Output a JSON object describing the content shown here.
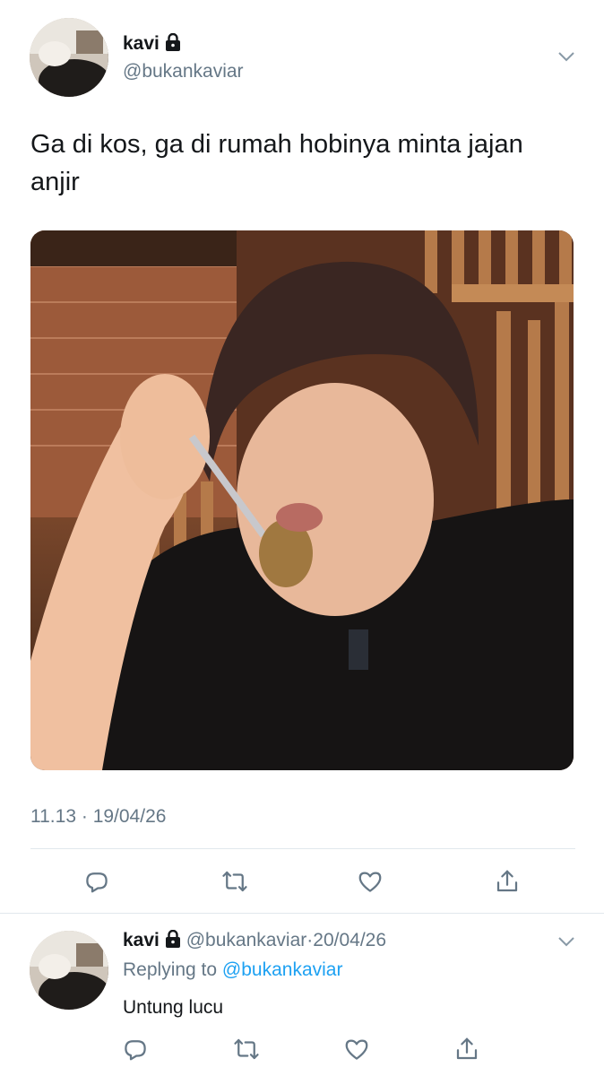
{
  "tweet": {
    "display_name": "kavi",
    "handle": "@bukankaviar",
    "text": "Ga di kos, ga di rumah hobinya minta jajan anjir",
    "time": "11.13",
    "separator": "·",
    "date": "19/04/26"
  },
  "reply": {
    "display_name": "kavi",
    "handle": "@bukankaviar",
    "separator": "·",
    "date": "20/04/26",
    "replying_prefix": "Replying to",
    "replying_to": "@bukankaviar",
    "text": "Untung lucu"
  },
  "icons": {
    "lock": "lock-icon",
    "chevron": "chevron-down-icon",
    "reply": "reply-icon",
    "retweet": "retweet-icon",
    "like": "heart-icon",
    "share": "share-icon"
  },
  "colors": {
    "link": "#1da1f2",
    "secondary_text": "#657786",
    "divider": "#e1e8ed"
  }
}
